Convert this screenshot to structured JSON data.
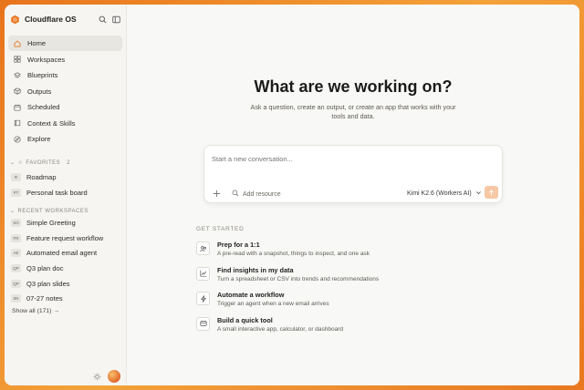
{
  "app": {
    "name": "Cloudflare OS",
    "accent": "#e8741c"
  },
  "sidebar": {
    "nav": [
      {
        "label": "Home",
        "icon": "home-icon",
        "active": true
      },
      {
        "label": "Workspaces",
        "icon": "grid-icon"
      },
      {
        "label": "Blueprints",
        "icon": "layers-icon"
      },
      {
        "label": "Outputs",
        "icon": "box-icon"
      },
      {
        "label": "Scheduled",
        "icon": "calendar-icon"
      },
      {
        "label": "Context & Skills",
        "icon": "book-icon"
      },
      {
        "label": "Explore",
        "icon": "compass-icon"
      }
    ],
    "favorites": {
      "label": "FAVORITES",
      "count": "2",
      "items": [
        {
          "badge": "R",
          "label": "Roadmap"
        },
        {
          "badge": "PT",
          "label": "Personal task board"
        }
      ]
    },
    "recent": {
      "label": "RECENT WORKSPACES",
      "items": [
        {
          "badge": "SG",
          "label": "Simple Greeting"
        },
        {
          "badge": "FR",
          "label": "Feature request workflow"
        },
        {
          "badge": "AE",
          "label": "Automated email agent"
        },
        {
          "badge": "QP",
          "label": "Q3 plan doc"
        },
        {
          "badge": "QP",
          "label": "Q3 plan slides"
        },
        {
          "badge": "0N",
          "label": "07-27 notes"
        }
      ],
      "show_all": "Show all (171) →"
    }
  },
  "main": {
    "title": "What are we working on?",
    "subtitle": "Ask a question, create an output, or create an app that works with your tools and data.",
    "composer": {
      "placeholder": "Start a new conversation...",
      "add_resource": "Add resource",
      "model": "Kimi K2.6 (Workers AI)"
    },
    "get_started": {
      "label": "GET STARTED",
      "items": [
        {
          "icon": "users-icon",
          "title": "Prep for a 1:1",
          "desc": "A pre-read with a snapshot, things to inspect, and one ask"
        },
        {
          "icon": "chart-icon",
          "title": "Find insights in my data",
          "desc": "Turn a spreadsheet or CSV into trends and recommendations"
        },
        {
          "icon": "bolt-icon",
          "title": "Automate a workflow",
          "desc": "Trigger an agent when a new email arrives"
        },
        {
          "icon": "tool-icon",
          "title": "Build a quick tool",
          "desc": "A small interactive app, calculator, or dashboard"
        }
      ]
    }
  }
}
